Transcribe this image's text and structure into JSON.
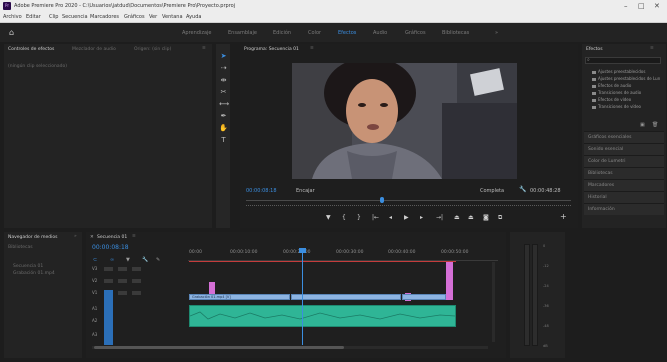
{
  "window": {
    "title": "Adobe Premiere Pro 2020 - C:\\Usuarios\\jatdud\\Documentos\\Premiere Pro\\Proyecto.prproj",
    "controls": {
      "minimize": "–",
      "maximize": "□",
      "close": "✕"
    }
  },
  "menu": [
    "Archivo",
    "Editar",
    "Clip",
    "Secuencia",
    "Marcadores",
    "Gráficos",
    "Ver",
    "Ventana",
    "Ayuda"
  ],
  "workspaces": {
    "home_icon": "home-icon",
    "tabs": [
      "Aprendizaje",
      "Ensamblaje",
      "Edición",
      "Color",
      "Efectos",
      "Audio",
      "Gráficos",
      "Bibliotecas"
    ],
    "active": "Efectos",
    "overflow": "»"
  },
  "source_panel": {
    "tabs": [
      "Controles de efectos",
      "Mezclador de audio",
      "Origen: (sin clip)"
    ],
    "empty_text": "(ningún clip seleccionado)"
  },
  "program_monitor": {
    "title": "Programa: Secuencia 01",
    "timecode": "00:00:08:18",
    "fit": "Encajar",
    "quality": "Completa",
    "duration": "00:00:48:28",
    "controls": [
      "marker-icon",
      "in-point-icon",
      "out-point-icon",
      "go-to-in-icon",
      "step-back-icon",
      "play-icon",
      "step-forward-icon",
      "go-to-out-icon",
      "lift-icon",
      "extract-icon",
      "export-frame-icon",
      "compare-icon",
      "plus-icon"
    ]
  },
  "effects_panel": {
    "title": "Efectos",
    "search_placeholder": "",
    "tree": [
      "Ajustes preestablecidos",
      "Ajustes preestablecidos de Lun",
      "Efectos de audio",
      "Transiciones de audio",
      "Efectos de vídeo",
      "Transiciones de vídeo"
    ],
    "sections": [
      "Gráficos esenciales",
      "Sonido esencial",
      "Color de Lumetri",
      "Bibliotecas",
      "Marcadores",
      "Historial",
      "Información"
    ]
  },
  "project_panel": {
    "tabs": [
      "Navegador de medios",
      "Bibliotecas"
    ],
    "items": [
      "Secuencia 01",
      "Grabación 01.mp4"
    ],
    "item_count": "2 elementos"
  },
  "timeline": {
    "tab": "Secuencia 01",
    "timecode": "00:00:08:18",
    "ruler": [
      "00:00",
      "00:00:10:00",
      "00:00:20:00",
      "00:00:30:00",
      "00:00:40:00",
      "00:00:50:00"
    ],
    "video_tracks": [
      "V3",
      "V2",
      "V1"
    ],
    "audio_tracks": [
      "A1",
      "A2",
      "A3"
    ],
    "clip_name": "Grabación 01.mp4 [V]"
  },
  "audio_meters": {
    "scale": [
      "0",
      "-12",
      "-24",
      "-36",
      "-48",
      "dB"
    ]
  },
  "colors": {
    "accent": "#3b8ee0",
    "video_clip": "#8db4e2",
    "audio_clip": "#2fb596",
    "marker_clip": "#d46fd6",
    "playhead": "#3b8ee0"
  }
}
